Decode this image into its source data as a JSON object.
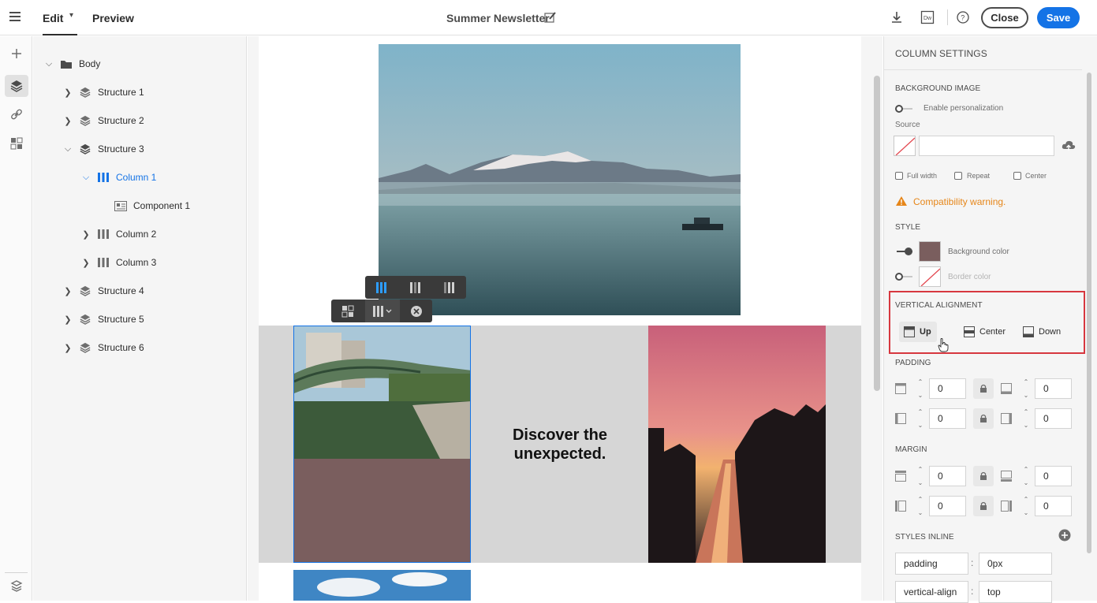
{
  "header": {
    "tab_edit": "Edit",
    "tab_preview": "Preview",
    "title": "Summer Newsletter",
    "close_label": "Close",
    "save_label": "Save",
    "icons": [
      "download-icon",
      "dreamweaver-export-icon",
      "help-icon"
    ]
  },
  "tree": {
    "root": "Body",
    "items": [
      {
        "label": "Structure 1"
      },
      {
        "label": "Structure 2"
      },
      {
        "label": "Structure 3"
      },
      {
        "label": "Column 1"
      },
      {
        "label": "Component 1"
      },
      {
        "label": "Column 2"
      },
      {
        "label": "Column 3"
      },
      {
        "label": "Structure 4"
      },
      {
        "label": "Structure 5"
      },
      {
        "label": "Structure 6"
      }
    ]
  },
  "canvas": {
    "headline": "Discover the unexpected."
  },
  "panel": {
    "title": "COLUMN SETTINGS",
    "bg_image": {
      "heading": "BACKGROUND IMAGE",
      "personalization": "Enable personalization",
      "source_label": "Source",
      "source_value": "",
      "full_width": "Full width",
      "repeat": "Repeat",
      "center": "Center",
      "warning": "Compatibility warning."
    },
    "style": {
      "heading": "STYLE",
      "bg_color_label": "Background color",
      "bg_color": "#7a5e5e",
      "border_color_label": "Border color"
    },
    "valign": {
      "heading": "VERTICAL ALIGNMENT",
      "up": "Up",
      "center": "Center",
      "down": "Down",
      "selected": "Up"
    },
    "padding": {
      "heading": "PADDING",
      "top": "0",
      "bottom": "0",
      "left": "0",
      "right": "0"
    },
    "margin": {
      "heading": "MARGIN",
      "top": "0",
      "bottom": "0",
      "left": "0",
      "right": "0"
    },
    "styles_inline": {
      "heading": "STYLES INLINE",
      "rows": [
        {
          "prop": "padding",
          "sep": ":",
          "value": "0px"
        },
        {
          "prop": "vertical-align",
          "sep": ":",
          "value": "top"
        }
      ]
    }
  },
  "colors": {
    "accent": "#1473e6",
    "warning": "#e68619",
    "highlight_border": "#d7373f"
  }
}
